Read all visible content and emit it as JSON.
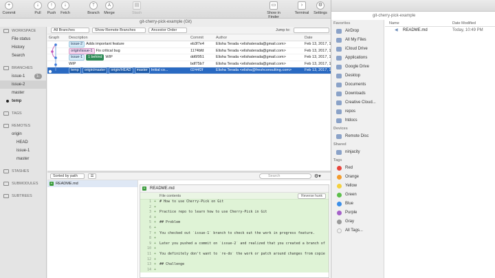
{
  "toolbar": {
    "commit": "Commit",
    "pull": "Pull",
    "push": "Push",
    "fetch": "Fetch",
    "branch": "Branch",
    "merge": "Merge",
    "stash": "Stash",
    "show_in_finder": "Show in Finder",
    "terminal": "Terminal",
    "settings": "Settings"
  },
  "window_title": "git-cherry-pick-example (Git)",
  "sidebar": {
    "workspace": "WORKSPACE",
    "file_status": "File status",
    "history": "History",
    "search": "Search",
    "branches": "BRANCHES",
    "branch_items": [
      {
        "label": "issue-1",
        "badge": "1↓"
      },
      {
        "label": "issue-2"
      },
      {
        "label": "master"
      },
      {
        "label": "temp"
      }
    ],
    "tags": "TAGS",
    "remotes": "REMOTES",
    "origin": "origin",
    "remote_items": [
      "HEAD",
      "issue-1",
      "master"
    ],
    "stashes": "STASHES",
    "submodules": "SUBMODULES",
    "subtrees": "SUBTREES"
  },
  "filters": {
    "branches": "All Branches",
    "remote": "Show Remote Branches",
    "order": "Ancestor Order",
    "jump_to": "Jump to:"
  },
  "columns": {
    "graph": "Graph",
    "description": "Description",
    "commit": "Commit",
    "author": "Author",
    "date": "Date"
  },
  "commits": [
    {
      "tags": [
        "issue-2"
      ],
      "message": "Adds important feature",
      "hash": "eb3f7e4",
      "author": "Elisha Terada <elishaterada@gmail.com>",
      "date": "Feb 13, 2017, 1"
    },
    {
      "tags": [
        "origin/issue-1"
      ],
      "message": "Fix critical bug",
      "hash": "1174bfd",
      "author": "Elisha Terada <elishaterada@gmail.com>",
      "date": "Feb 13, 2017, 1"
    },
    {
      "tags": [
        "issue-1",
        "1 behind"
      ],
      "message": "WIP",
      "hash": "dd6f951",
      "author": "Elisha Terada <elishaterada@gmail.com>",
      "date": "Feb 13, 2017, 1"
    },
    {
      "tags": [],
      "message": "WIP",
      "hash": "bdf75b7",
      "author": "Elisha Terada <elishaterada@gmail.com>",
      "date": "Feb 13, 2017, 1"
    },
    {
      "tags": [
        "temp",
        "origin/master",
        "origin/HEAD",
        "master"
      ],
      "message": "Initial co...",
      "hash": "0244f2f",
      "author": "Elisha Terada <elisha@freshconsulting.com>",
      "date": "Feb 13, 2017, 1"
    }
  ],
  "lower": {
    "sort": "Sorted by path",
    "search_placeholder": "Search",
    "file": "README.md",
    "file_contents": "File contents",
    "reverse_hunk": "Reverse hunk"
  },
  "diff_lines": [
    {
      "n": "1",
      "t": "# How to use Cherry-Pick on Git"
    },
    {
      "n": "2",
      "t": ""
    },
    {
      "n": "3",
      "t": "Practice repo to learn how to use Cherry-Pick in Git"
    },
    {
      "n": "4",
      "t": ""
    },
    {
      "n": "5",
      "t": "## Problem"
    },
    {
      "n": "6",
      "t": ""
    },
    {
      "n": "7",
      "t": "You checked out `issue-1` branch to check out the work in progress feature."
    },
    {
      "n": "8",
      "t": ""
    },
    {
      "n": "9",
      "t": "Later you pushed a commit on `issue-2` and realized that you created a branch of"
    },
    {
      "n": "10",
      "t": ""
    },
    {
      "n": "11",
      "t": "You definitely don't want to `re-do` the work or patch around changes from copie"
    },
    {
      "n": "12",
      "t": ""
    },
    {
      "n": "13",
      "t": "## Challenge"
    },
    {
      "n": "14",
      "t": ""
    }
  ],
  "finder": {
    "title": "git-cherry-pick-example",
    "favorites": "Favorites",
    "fav_items": [
      "AirDrop",
      "All My Files",
      "iCloud Drive",
      "Applications",
      "Google Drive",
      "Desktop",
      "Documents",
      "Downloads",
      "Creative Cloud...",
      "repos",
      "htdocs"
    ],
    "devices": "Devices",
    "dev_items": [
      "Remote Disc"
    ],
    "shared": "Shared",
    "shared_items": [
      "ninjacity"
    ],
    "tags": "Tags",
    "tag_items": [
      {
        "label": "Red",
        "color": "#e8453c"
      },
      {
        "label": "Orange",
        "color": "#f39c2b"
      },
      {
        "label": "Yellow",
        "color": "#f4d13d"
      },
      {
        "label": "Green",
        "color": "#5cbf4a"
      },
      {
        "label": "Blue",
        "color": "#3b8ee8"
      },
      {
        "label": "Purple",
        "color": "#a561c9"
      },
      {
        "label": "Gray",
        "color": "#9a9a9a"
      },
      {
        "label": "All Tags...",
        "color": ""
      }
    ],
    "col_name": "Name",
    "col_date": "Date Modified",
    "file": "README.md",
    "file_date": "Today, 10:49 PM"
  }
}
